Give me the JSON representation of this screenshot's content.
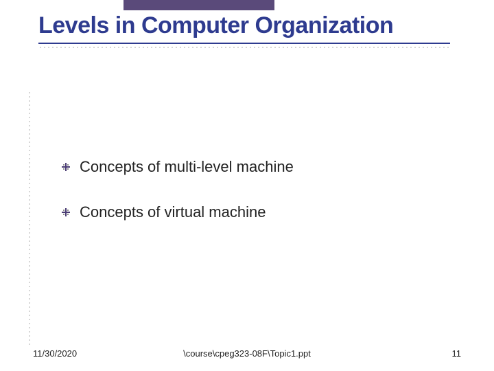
{
  "slide": {
    "title": "Levels in Computer Organization",
    "bullets": [
      {
        "text": "Concepts of multi-level machine"
      },
      {
        "text": "Concepts of virtual machine"
      }
    ]
  },
  "footer": {
    "date": "11/30/2020",
    "path": "\\course\\cpeg323-08F\\Topic1.ppt",
    "page": "11"
  }
}
